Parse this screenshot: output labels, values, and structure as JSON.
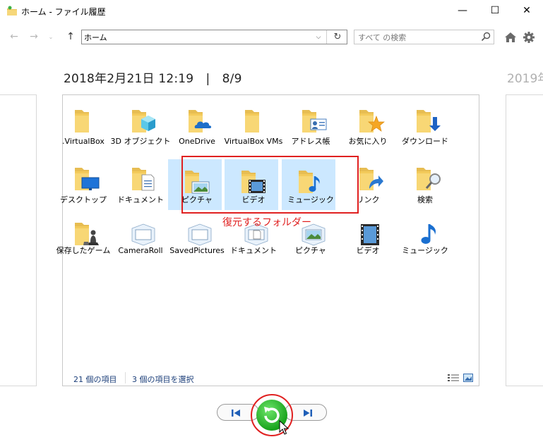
{
  "window": {
    "title": "ホーム - ファイル履歴",
    "minimize_glyph": "—",
    "maximize_glyph": "☐",
    "close_glyph": "✕"
  },
  "nav": {
    "address": "ホーム",
    "search_placeholder": "すべて の検索"
  },
  "date_label": "2018年2月21日 12:19　|　8/9",
  "next_date_label": "2019年",
  "items": [
    {
      "label": ".VirtualBox",
      "icon": "folder-icon",
      "selected": false
    },
    {
      "label": "3D オブジェクト",
      "icon": "3d-objects-folder-icon",
      "selected": false
    },
    {
      "label": "OneDrive",
      "icon": "onedrive-folder-icon",
      "selected": false
    },
    {
      "label": "VirtualBox VMs",
      "icon": "folder-icon",
      "selected": false
    },
    {
      "label": "アドレス帳",
      "icon": "contacts-folder-icon",
      "selected": false
    },
    {
      "label": "お気に入り",
      "icon": "favorites-folder-icon",
      "selected": false
    },
    {
      "label": "ダウンロード",
      "icon": "downloads-folder-icon",
      "selected": false
    },
    {
      "label": "デスクトップ",
      "icon": "desktop-folder-icon",
      "selected": false
    },
    {
      "label": "ドキュメント",
      "icon": "documents-folder-icon",
      "selected": false
    },
    {
      "label": "ピクチャ",
      "icon": "pictures-folder-icon",
      "selected": true
    },
    {
      "label": "ビデオ",
      "icon": "videos-folder-icon",
      "selected": true
    },
    {
      "label": "ミュージック",
      "icon": "music-folder-icon",
      "selected": true
    },
    {
      "label": "リンク",
      "icon": "links-folder-icon",
      "selected": false
    },
    {
      "label": "検索",
      "icon": "search-folder-icon",
      "selected": false
    },
    {
      "label": "保存したゲーム",
      "icon": "saved-games-folder-icon",
      "selected": false
    },
    {
      "label": "CameraRoll",
      "icon": "camera-roll-library-icon",
      "selected": false
    },
    {
      "label": "SavedPictures",
      "icon": "saved-pictures-library-icon",
      "selected": false
    },
    {
      "label": "ドキュメント",
      "icon": "documents-library-icon",
      "selected": false
    },
    {
      "label": "ピクチャ",
      "icon": "pictures-library-icon",
      "selected": false
    },
    {
      "label": "ビデオ",
      "icon": "videos-library-icon",
      "selected": false
    },
    {
      "label": "ミュージック",
      "icon": "music-library-icon",
      "selected": false
    }
  ],
  "status": {
    "count": "21 個の項目",
    "selected": "3 個の項目を選択"
  },
  "annotation": {
    "text": "復元するフォルダー",
    "color": "#e02020"
  },
  "colors": {
    "selection": "#cce8ff",
    "restore_green": "#22b020",
    "nav_blue": "#1f5fb8"
  }
}
